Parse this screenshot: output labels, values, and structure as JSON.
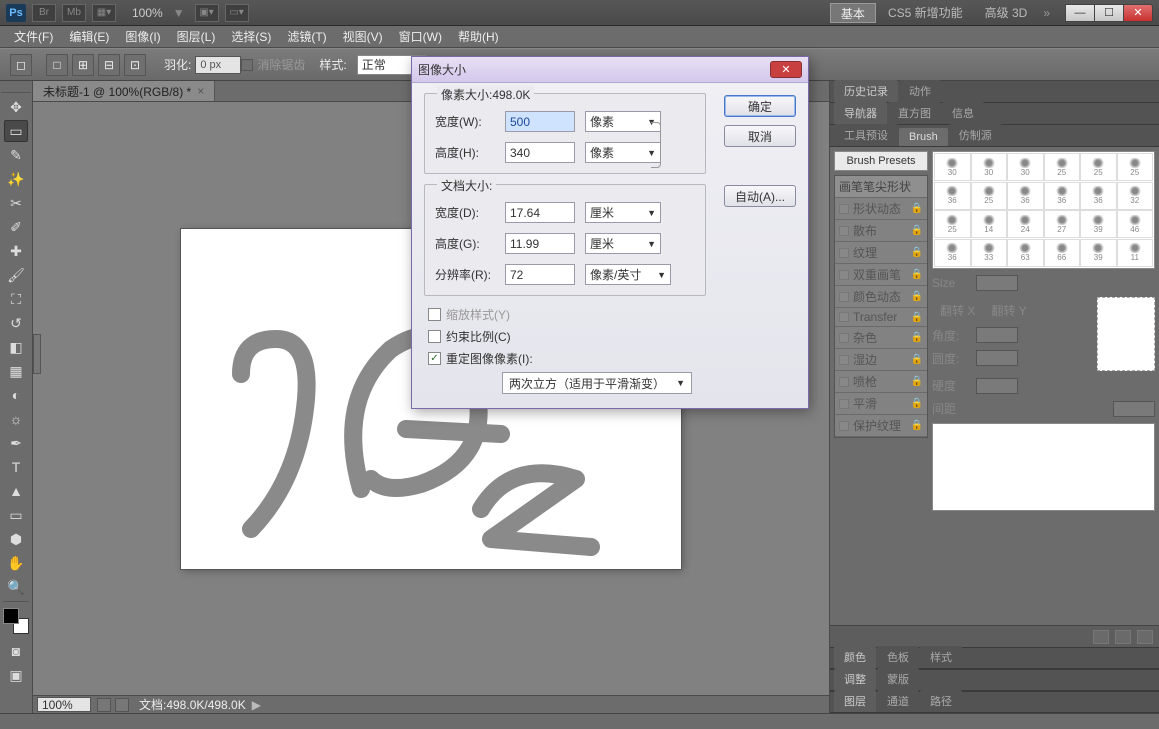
{
  "topbar": {
    "ps": "Ps",
    "br": "Br",
    "mb": "Mb",
    "zoom": "100%",
    "ws_basic": "基本",
    "ws_new": "CS5 新增功能",
    "ws_3d": "高级 3D",
    "arrows": "»"
  },
  "menu": {
    "file": "文件(F)",
    "edit": "编辑(E)",
    "image": "图像(I)",
    "layer": "图层(L)",
    "select": "选择(S)",
    "filter": "滤镜(T)",
    "view": "视图(V)",
    "window": "窗口(W)",
    "help": "帮助(H)"
  },
  "options": {
    "feather_lbl": "羽化:",
    "feather_val": "0 px",
    "antialias": "消除锯齿",
    "style_lbl": "样式:",
    "style_val": "正常"
  },
  "doc": {
    "tab": "未标题-1 @ 100%(RGB/8) *",
    "status_zoom": "100%",
    "status_doc": "文档:498.0K/498.0K"
  },
  "panels": {
    "history": "历史记录",
    "actions": "动作",
    "navigator": "导航器",
    "histogram": "直方图",
    "info": "信息",
    "toolpresets": "工具预设",
    "brush": "Brush",
    "clone": "仿制源",
    "brush_presets_btn": "Brush Presets",
    "bp_head": "画笔笔尖形状",
    "bp_dyn": "形状动态",
    "bp_scatter": "散布",
    "bp_texture": "纹理",
    "bp_dual": "双重画笔",
    "bp_color": "颜色动态",
    "bp_transfer": "Transfer",
    "bp_misc": "杂色",
    "bp_wet": "湿边",
    "bp_air": "喷枪",
    "bp_smooth": "平滑",
    "bp_protect": "保护纹理",
    "size": "Size",
    "flipx": "翻转 X",
    "flipy": "翻转 Y",
    "angle": "角度:",
    "round": "圆度:",
    "hard": "硬度",
    "spacing": "间距",
    "col_color": "颜色",
    "col_swatch": "色板",
    "col_styles": "样式",
    "col_adjust": "调整",
    "col_mask": "蒙版",
    "col_layers": "图层",
    "col_channels": "通道",
    "col_paths": "路径"
  },
  "dialog": {
    "title": "图像大小",
    "pixdim_title": "像素大小:498.0K",
    "width_w": "宽度(W):",
    "width_w_val": "500",
    "height_h": "高度(H):",
    "height_h_val": "340",
    "unit_px": "像素",
    "docsize_title": "文档大小:",
    "width_d": "宽度(D):",
    "width_d_val": "17.64",
    "height_g": "高度(G):",
    "height_g_val": "11.99",
    "unit_cm": "厘米",
    "res_r": "分辨率(R):",
    "res_val": "72",
    "unit_ppi": "像素/英寸",
    "scale_styles": "缩放样式(Y)",
    "constrain": "约束比例(C)",
    "resample": "重定图像像素(I):",
    "method": "两次立方（适用于平滑渐变）",
    "ok": "确定",
    "cancel": "取消",
    "auto": "自动(A)..."
  }
}
